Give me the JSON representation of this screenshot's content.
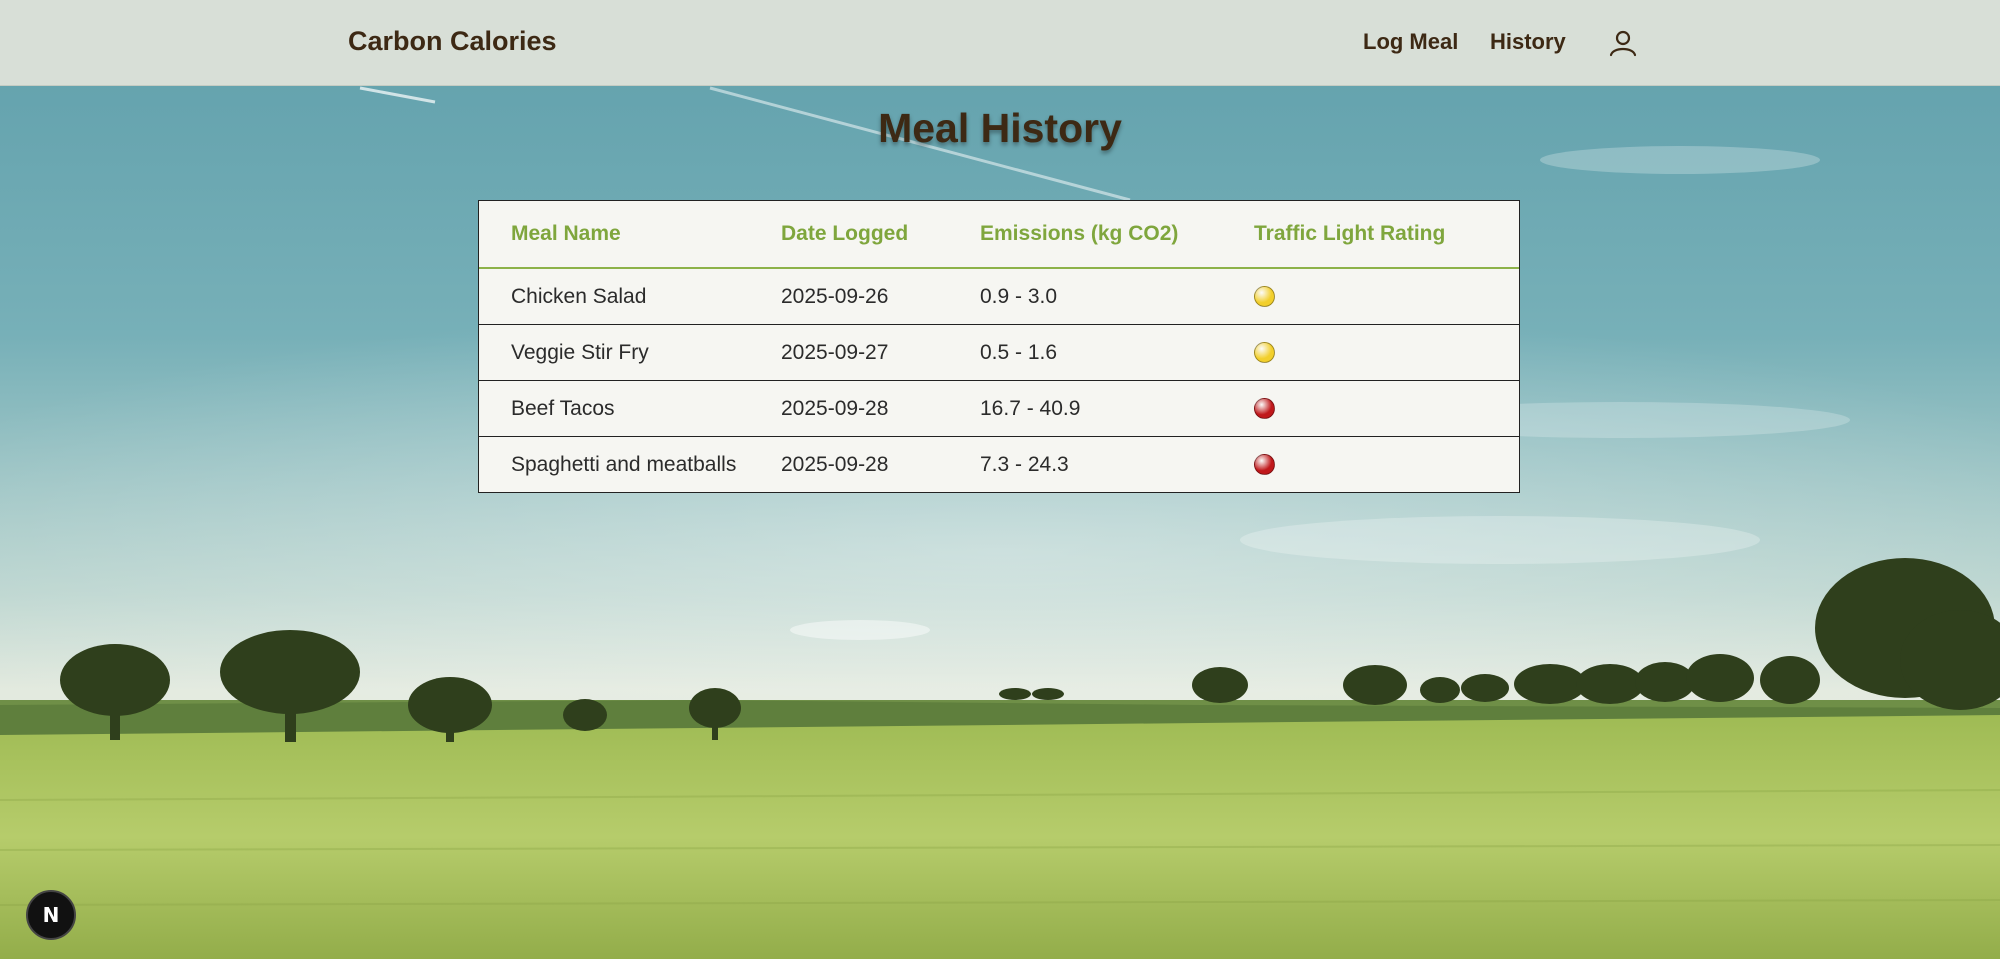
{
  "header": {
    "brand": "Carbon Calories",
    "nav": {
      "log_meal": "Log Meal",
      "history": "History"
    },
    "user_icon": "user-icon"
  },
  "main": {
    "title": "Meal History",
    "table": {
      "headers": [
        "Meal Name",
        "Date Logged",
        "Emissions (kg CO2)",
        "Traffic Light Rating"
      ],
      "rows": [
        {
          "meal": "Chicken Salad",
          "date": "2025-09-26",
          "emissions": "0.9 - 3.0",
          "rating": "yellow"
        },
        {
          "meal": "Veggie Stir Fry",
          "date": "2025-09-27",
          "emissions": "0.5 - 1.6",
          "rating": "yellow"
        },
        {
          "meal": "Beef Tacos",
          "date": "2025-09-28",
          "emissions": "16.7 - 40.9",
          "rating": "red"
        },
        {
          "meal": "Spaghetti and meatballs",
          "date": "2025-09-28",
          "emissions": "7.3 - 24.3",
          "rating": "red"
        }
      ]
    }
  },
  "badge": {
    "label": "N",
    "icon": "nextjs-logo-icon"
  },
  "colors": {
    "header_bg": "#d8dfd7",
    "brand_text": "#3d2914",
    "table_header_text": "#7fa63d",
    "rating_yellow": "#f2cf2c",
    "rating_red": "#c0181b"
  }
}
